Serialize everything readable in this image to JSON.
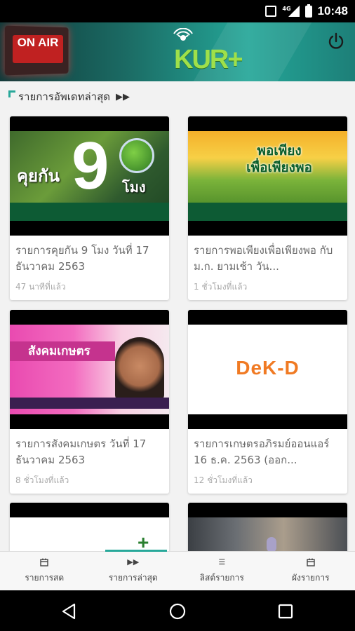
{
  "status_bar": {
    "time": "10:48",
    "network": "4G",
    "icons": [
      "vibrate-icon",
      "signal-icon",
      "battery-charging-icon"
    ]
  },
  "header": {
    "on_air": "ON AIR",
    "logo": "KUR+",
    "power_icon": "power-icon"
  },
  "section": {
    "title": "รายการอัพเดทล่าสุด",
    "icon": "fast-forward-icon"
  },
  "thumbnails": {
    "card1": {
      "line1": "คุยกัน",
      "big": "9",
      "line2": "โมง"
    },
    "card2": {
      "line1": "พอเพียง",
      "line2": "เพื่อเพียงพอ"
    },
    "card3": {
      "line1": "สังคมเกษตร"
    },
    "card4": {
      "line1": "DeK-D"
    }
  },
  "cards": [
    {
      "title": "รายการคุยกัน 9 โมง วันที่ 17 ธันวาคม 2563",
      "time": "47 นาทีที่แล้ว"
    },
    {
      "title": "รายการพอเพียงเพื่อเพียงพอ กับ ม.ก. ยามเช้า วัน...",
      "time": "1 ชั่วโมงที่แล้ว"
    },
    {
      "title": "รายการสังคมเกษตร วันที่ 17 ธันวาคม 2563",
      "time": "8 ชั่วโมงที่แล้ว"
    },
    {
      "title": "รายการเกษตรอภิรมย์ออนแอร์ 16 ธ.ค. 2563 (ออก...",
      "time": "12 ชั่วโมงที่แล้ว"
    }
  ],
  "bottom_nav": [
    {
      "label": "รายการสด",
      "icon": "calendar-icon"
    },
    {
      "label": "รายการล่าสุด",
      "icon": "fast-forward-icon"
    },
    {
      "label": "ลิสต์รายการ",
      "icon": "list-icon"
    },
    {
      "label": "ผังรายการ",
      "icon": "calendar-icon"
    }
  ],
  "accent_color": "#28a89a"
}
